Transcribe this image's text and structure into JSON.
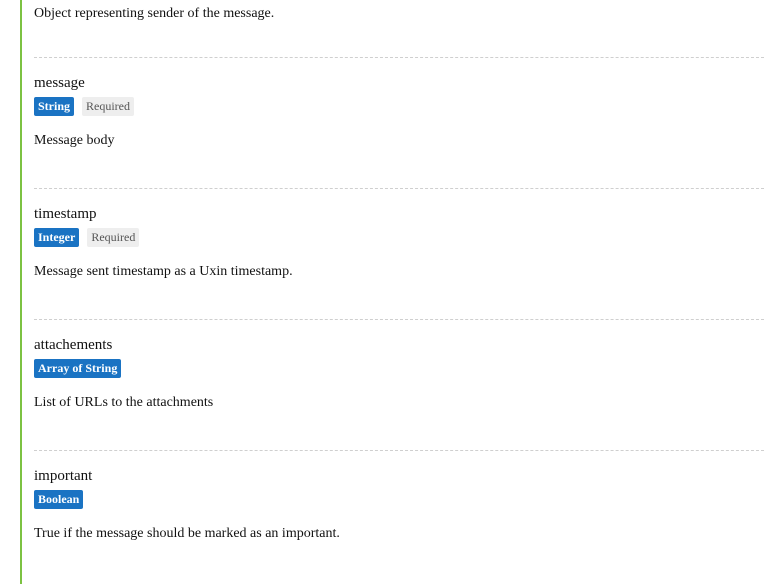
{
  "sender": {
    "description": "Object representing sender of the message."
  },
  "fields": [
    {
      "name": "message",
      "type": "String",
      "required": "Required",
      "description": "Message body"
    },
    {
      "name": "timestamp",
      "type": "Integer",
      "required": "Required",
      "description": "Message sent timestamp as a Uxin timestamp."
    },
    {
      "name": "attachements",
      "type": "Array of String",
      "description": "List of URLs to the attachments"
    },
    {
      "name": "important",
      "type": "Boolean",
      "description": "True if the message should be marked as an important."
    }
  ],
  "colors": {
    "accent_border": "#7cc242",
    "type_badge_bg": "#1a73c3",
    "required_badge_bg": "#eeeeee"
  }
}
